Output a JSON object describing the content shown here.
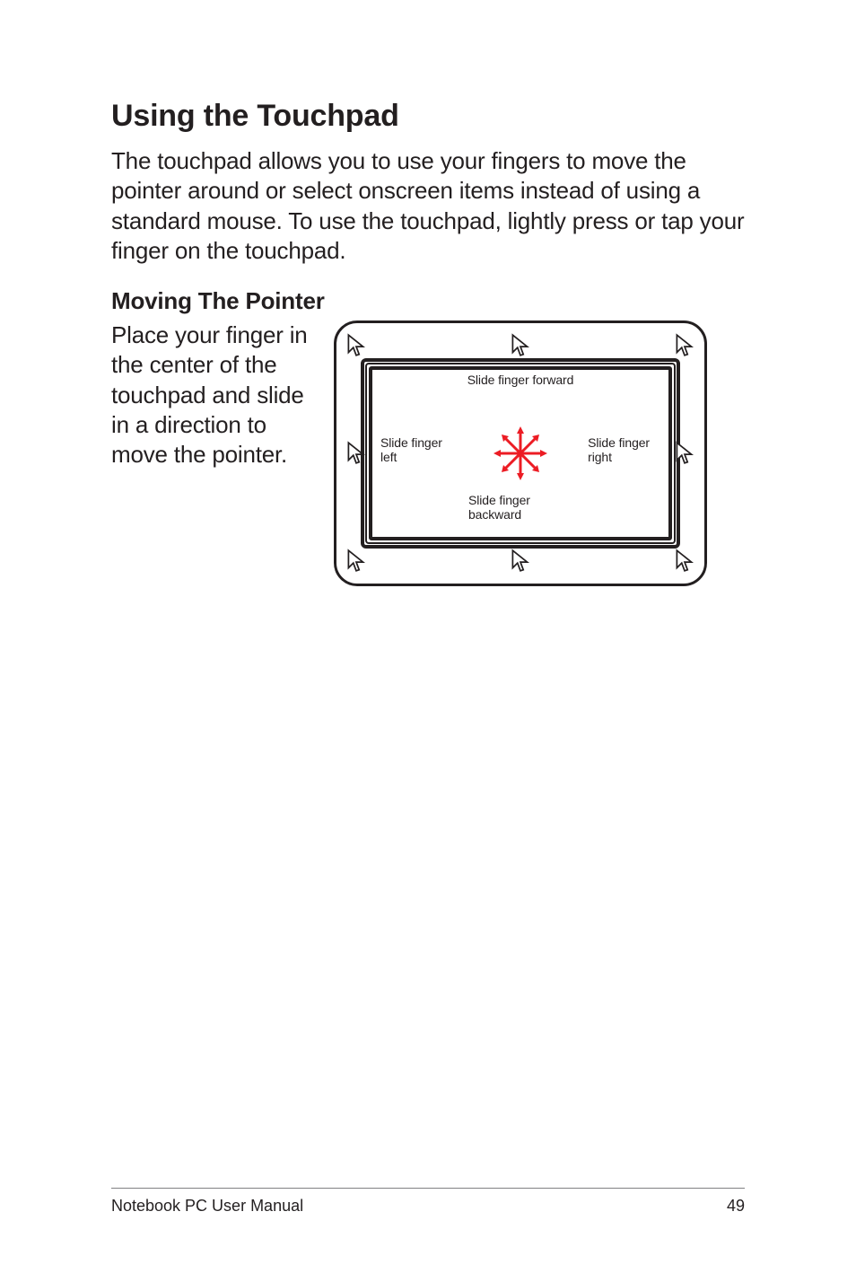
{
  "heading_main": "Using the Touchpad",
  "intro": "The touchpad allows you to use your fingers to move the pointer around or select onscreen items instead of using a standard mouse. To use the touchpad, lightly press or tap your finger on the touchpad.",
  "heading_sub": "Moving The Pointer",
  "side_text": "Place your finger in the center of the touchpad and slide in a direction to move the pointer.",
  "diagram": {
    "forward": "Slide finger forward",
    "left": "Slide finger\nleft",
    "right": "Slide finger\nright",
    "backward": "Slide finger\nbackward",
    "direction_star_color": "#ec1c24"
  },
  "footer": {
    "title": "Notebook PC User Manual",
    "page_number": "49"
  }
}
